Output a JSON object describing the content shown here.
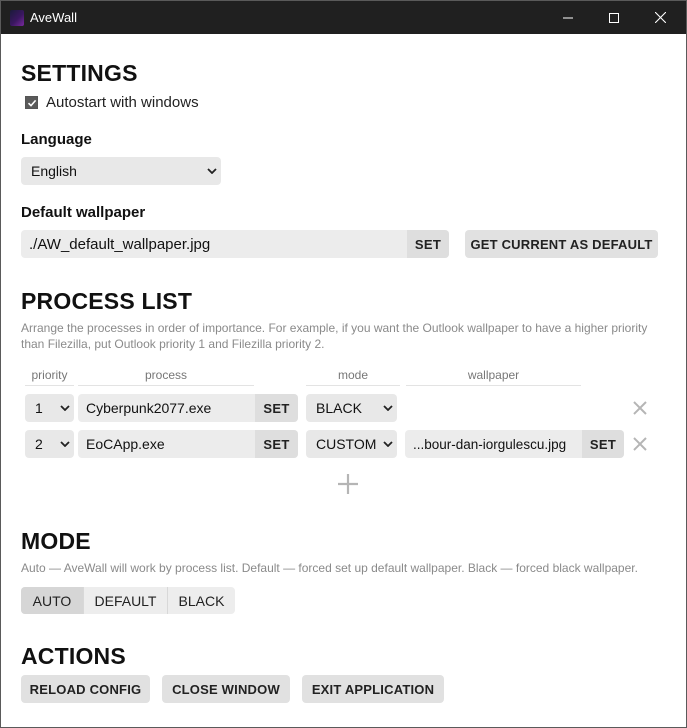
{
  "window": {
    "title": "AveWall"
  },
  "settings": {
    "heading": "SETTINGS",
    "autostart_label": "Autostart with windows",
    "autostart_checked": true,
    "language_label": "Language",
    "language_value": "English",
    "default_wallpaper_label": "Default wallpaper",
    "default_wallpaper_value": "./AW_default_wallpaper.jpg",
    "set_label": "SET",
    "get_current_label": "GET CURRENT AS DEFAULT"
  },
  "process_list": {
    "heading": "PROCESS LIST",
    "description": "Arrange the processes in order of importance. For example, if you want the Outlook wallpaper to have a higher priority than Filezilla, put Outlook priority 1 and Filezilla priority 2.",
    "columns": {
      "priority": "priority",
      "process": "process",
      "mode": "mode",
      "wallpaper": "wallpaper"
    },
    "rows": [
      {
        "priority": "1",
        "process": "Cyberpunk2077.exe",
        "set_label": "SET",
        "mode": "BLACK",
        "wallpaper": "",
        "wallpaper_set_label": ""
      },
      {
        "priority": "2",
        "process": "EoCApp.exe",
        "set_label": "SET",
        "mode": "CUSTOM",
        "wallpaper": "...bour-dan-iorgulescu.jpg",
        "wallpaper_set_label": "SET"
      }
    ]
  },
  "mode": {
    "heading": "MODE",
    "description": "Auto — AveWall will work by process list. Default — forced set up default wallpaper. Black — forced black wallpaper.",
    "options": [
      "AUTO",
      "DEFAULT",
      "BLACK"
    ],
    "selected": "AUTO"
  },
  "actions": {
    "heading": "ACTIONS",
    "reload": "RELOAD CONFIG",
    "close": "CLOSE WINDOW",
    "exit": "EXIT APPLICATION"
  },
  "icons": {
    "app": "avewall-app-icon",
    "minimize": "minimize-icon",
    "maximize": "maximize-icon",
    "close": "close-icon",
    "dropdown": "chevron-down-icon",
    "remove": "remove-x-icon",
    "add": "plus-icon",
    "checkbox": "checkmark-icon"
  },
  "colors": {
    "titlebar": "#202020",
    "button_bg": "#e1e1e1",
    "field_bg": "#ececec",
    "note_text": "#8a8a8a"
  }
}
